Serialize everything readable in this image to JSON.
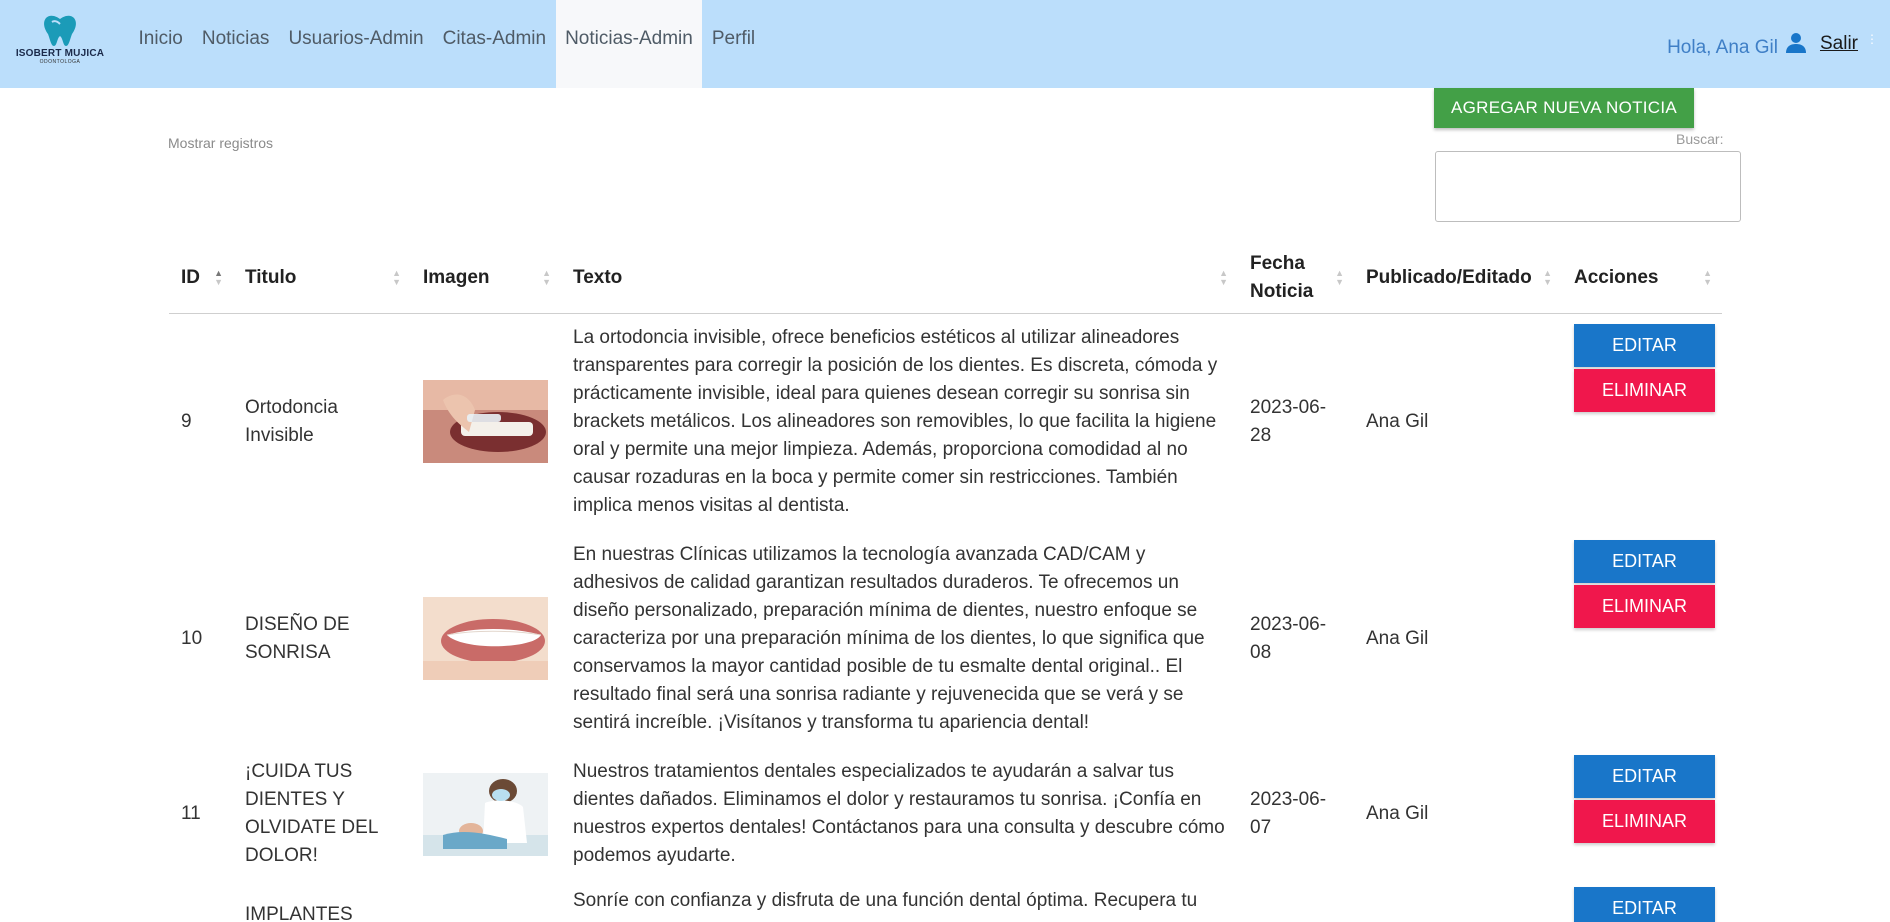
{
  "brand": {
    "name": "ISOBERT MUJICA",
    "subtitle": "ODONTOLOGA",
    "color": "#1b9bb8"
  },
  "nav": {
    "items": [
      "Inicio",
      "Noticias",
      "Usuarios-Admin",
      "Citas-Admin",
      "Noticias-Admin",
      "Perfil"
    ],
    "active": "Noticias-Admin",
    "background": "#bbdefb"
  },
  "user": {
    "greeting": "Hola, Ana Gil",
    "logout": "Salir"
  },
  "toolbar": {
    "add_label": "AGREGAR NUEVA NOTICIA",
    "show_records": "Mostrar registros",
    "search_label": "Buscar:",
    "search_value": ""
  },
  "table": {
    "columns": [
      "ID",
      "Titulo",
      "Imagen",
      "Texto",
      "Fecha Noticia",
      "Publicado/Editado",
      "Acciones"
    ],
    "sorted_column": "ID",
    "edit_label": "EDITAR",
    "delete_label": "ELIMINAR",
    "rows": [
      {
        "id": "9",
        "title": "Ortodoncia Invisible",
        "image": "aligner-photo",
        "text": "La ortodoncia invisible, ofrece beneficios estéticos al utilizar alineadores transparentes para corregir la posición de los dientes. Es discreta, cómoda y prácticamente invisible, ideal para quienes desean corregir su sonrisa sin brackets metálicos. Los alineadores son removibles, lo que facilita la higiene oral y permite una mejor limpieza. Además, proporciona comodidad al no causar rozaduras en la boca y permite comer sin restricciones. También implica menos visitas al dentista.",
        "date": "2023-06-28",
        "author": "Ana Gil"
      },
      {
        "id": "10",
        "title": "DISEÑO DE SONRISA",
        "image": "smile-photo",
        "text": "En nuestras Clínicas utilizamos la tecnología avanzada CAD/CAM y adhesivos de calidad garantizan resultados duraderos. Te ofrecemos un diseño personalizado, preparación mínima de dientes, nuestro enfoque se caracteriza por una preparación mínima de los dientes, lo que significa que conservamos la mayor cantidad posible de tu esmalte dental original.. El resultado final será una sonrisa radiante y rejuvenecida que se verá y se sentirá increíble. ¡Visítanos y transforma tu apariencia dental!",
        "date": "2023-06-08",
        "author": "Ana Gil"
      },
      {
        "id": "11",
        "title": "¡CUIDA TUS DIENTES Y OLVIDATE DEL DOLOR!",
        "image": "dentist-photo",
        "text": "Nuestros tratamientos dentales especializados te ayudarán a salvar tus dientes dañados. Eliminamos el dolor y restauramos tu sonrisa. ¡Confía en nuestros expertos dentales! Contáctanos para una consulta y descubre cómo podemos ayudarte.",
        "date": "2023-06-07",
        "author": "Ana Gil"
      },
      {
        "id": "",
        "title": "IMPLANTES",
        "image": "",
        "text": "Sonríe con confianza y disfruta de una función dental óptima. Recupera tu",
        "date": "",
        "author": ""
      }
    ]
  }
}
